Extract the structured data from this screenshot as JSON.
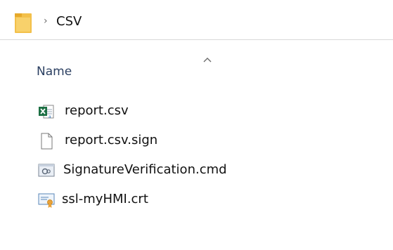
{
  "breadcrumb": {
    "items": [
      {
        "label": "CSV"
      }
    ]
  },
  "list": {
    "column_name": "Name",
    "sort_direction": "ascending",
    "files": [
      {
        "name": "report.csv",
        "icon": "excel-csv-icon"
      },
      {
        "name": "report.csv.sign",
        "icon": "blank-file-icon"
      },
      {
        "name": "SignatureVerification.cmd",
        "icon": "cmd-script-icon"
      },
      {
        "name": "ssl-myHMI.crt",
        "icon": "certificate-icon"
      }
    ]
  },
  "colors": {
    "folder": "#f3c04a",
    "excel_green": "#1d7044",
    "header_text": "#2b3f61"
  }
}
